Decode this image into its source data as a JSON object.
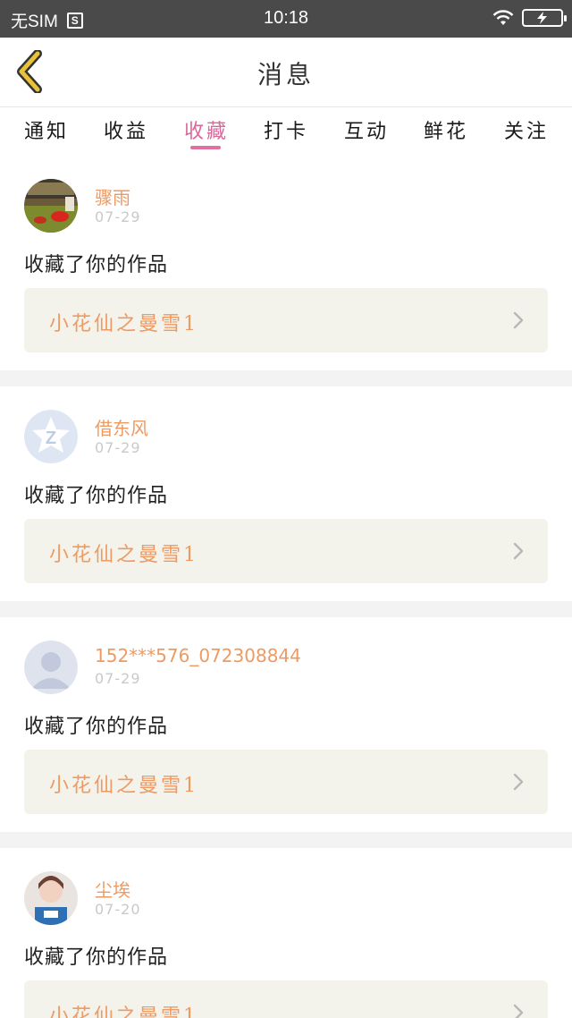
{
  "status_bar": {
    "carrier": "无SIM",
    "sim_icon_letter": "S",
    "time": "10:18"
  },
  "nav": {
    "title": "消息"
  },
  "tabs": [
    {
      "label": "通知",
      "active": false
    },
    {
      "label": "收益",
      "active": false
    },
    {
      "label": "收藏",
      "active": true
    },
    {
      "label": "打卡",
      "active": false
    },
    {
      "label": "互动",
      "active": false
    },
    {
      "label": "鲜花",
      "active": false
    },
    {
      "label": "关注",
      "active": false
    }
  ],
  "messages": [
    {
      "username": "骤雨",
      "date": "07-29",
      "action": "收藏了你的作品",
      "work_title": "小花仙之曼雪1"
    },
    {
      "username": "借东风",
      "date": "07-29",
      "action": "收藏了你的作品",
      "work_title": "小花仙之曼雪1"
    },
    {
      "username": "152***576_072308844",
      "date": "07-29",
      "action": "收藏了你的作品",
      "work_title": "小花仙之曼雪1"
    },
    {
      "username": "尘埃",
      "date": "07-20",
      "action": "收藏了你的作品",
      "work_title": "小花仙之曼雪1"
    }
  ],
  "colors": {
    "accent_pink": "#d9689a",
    "name_orange": "#ee9a63",
    "back_arrow_yellow": "#e8c33a",
    "card_bg": "#f3f3ec"
  }
}
